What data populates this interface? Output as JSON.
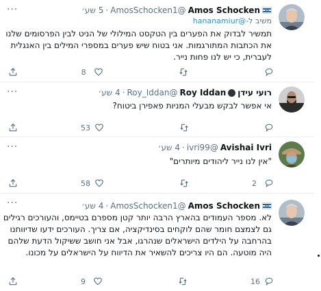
{
  "tweets": [
    {
      "name": "Amos Schocken",
      "handle": "@AmosSchocken1",
      "sep": "·",
      "time": "5 שע׳",
      "reply_prefix": "משיב ל-",
      "reply_mention": "@hananamiur",
      "text": "תמשיר לבדוק את הפערים בין הטקסט המילולי של הניט לבין הפרסומים שלנו את הכתבות המתורגמות. אני בטוח שיש פערים במספרי המילים בין האנגלית לעברית, כי יש לנו פחות נייר.",
      "reply_count": "",
      "retweet_count": "",
      "like_count": "8"
    },
    {
      "name": "רועי עידן",
      "name2": "Roy Iddan",
      "handle": "@Roy_Iddan",
      "sep": "·",
      "time": "4 שע׳",
      "text": "אי אפשר לבקש מבעלי המניות פאפירן ביטוח?",
      "reply_count": "",
      "retweet_count": "",
      "like_count": "53"
    },
    {
      "name": "Avishai Ivri",
      "handle": "@ivri99",
      "sep": "·",
      "time": "4 שע׳",
      "text": "\"אין לנו נייר ליהודים מיותרים\"",
      "reply_count": "2",
      "retweet_count": "",
      "like_count": "58"
    },
    {
      "name": "Amos Schocken",
      "handle": "@AmosSchocken1",
      "sep": "·",
      "time": "4 שע׳",
      "text": "לא. מספר העמודים בהארץ הרבה יותר קטן מספרם בטיימס, והעורכים רגילים גם לצמצם חומר שהם לוקחים בסינדיקציה, אם צריך. העורכים ידעו שדיווחנו בהרחבה על הילדים הישראלים שנהרגו, אבל אני חושב ששיקול הדעת שלהם היה מוטעה. הם היו צריכים להשאיר את הדיווח על הישראלים על מכונו.",
      "reply_count": "16",
      "retweet_count": "",
      "like_count": "9"
    }
  ],
  "ui": {
    "more_glyph": "···",
    "colors": {
      "text": "#0f1419",
      "muted": "#5b7083",
      "link": "#1b95e0",
      "divider": "#ebeef0"
    }
  }
}
